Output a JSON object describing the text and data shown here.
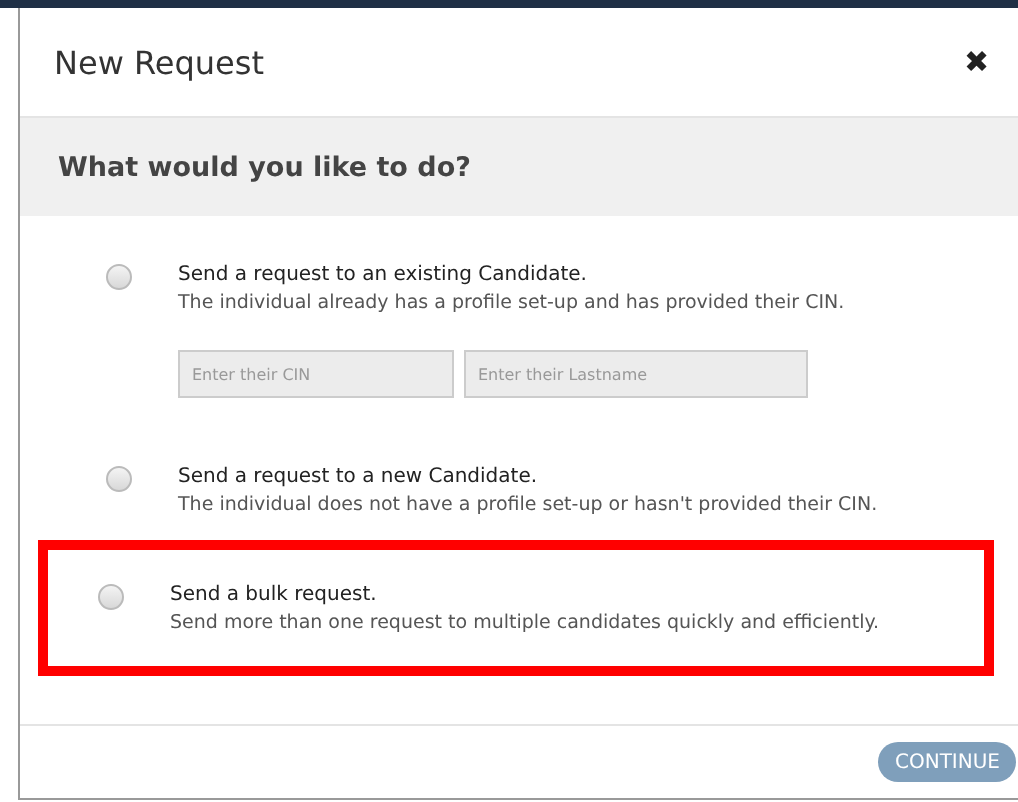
{
  "dialog": {
    "title": "New Request",
    "close": "✖"
  },
  "prompt": "What would you like to do?",
  "options": [
    {
      "title": "Send a request to an existing Candidate.",
      "description": "The individual already has a profile set-up and has provided their CIN.",
      "selected": false,
      "highlighted": false,
      "fields": [
        {
          "placeholder": "Enter their CIN"
        },
        {
          "placeholder": "Enter their Lastname"
        }
      ]
    },
    {
      "title": "Send a request to a new Candidate.",
      "description": "The individual does not have a profile set-up or hasn't provided their CIN.",
      "selected": false,
      "highlighted": false
    },
    {
      "title": "Send a bulk request.",
      "description": "Send more than one request to multiple candidates quickly and efficiently.",
      "selected": false,
      "highlighted": true
    }
  ],
  "continue_button": {
    "label": "CONTINUE",
    "disabled": true
  }
}
